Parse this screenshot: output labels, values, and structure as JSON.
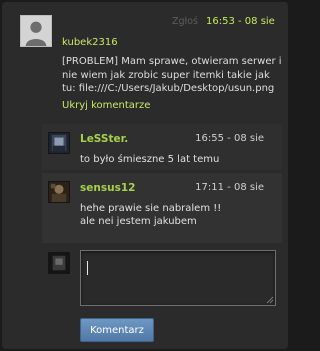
{
  "post": {
    "report_label": "Zgłoś",
    "time": "16:53 - 08 sie",
    "author": "kubek2316",
    "text": "[PROBLEM] Mam sprawe, otwieram serwer i nie wiem jak zrobic super itemki takie jak tu: file:///C:/Users/Jakub/Desktop/usun.png",
    "hide_label": "Ukryj komentarze"
  },
  "replies": [
    {
      "author": "LeSSter.",
      "time": "16:55 - 08 sie",
      "text": "to było śmieszne 5 lat temu"
    },
    {
      "author": "sensus12",
      "time": "17:11 - 08 sie",
      "text": "hehe prawie sie nabralem !! ale nei jestem jakubem"
    }
  ],
  "reply_form": {
    "textarea_value": "",
    "submit_label": "Komentarz"
  },
  "colors": {
    "accent_green": "#c9e868",
    "button_blue": "#5a84b3"
  }
}
